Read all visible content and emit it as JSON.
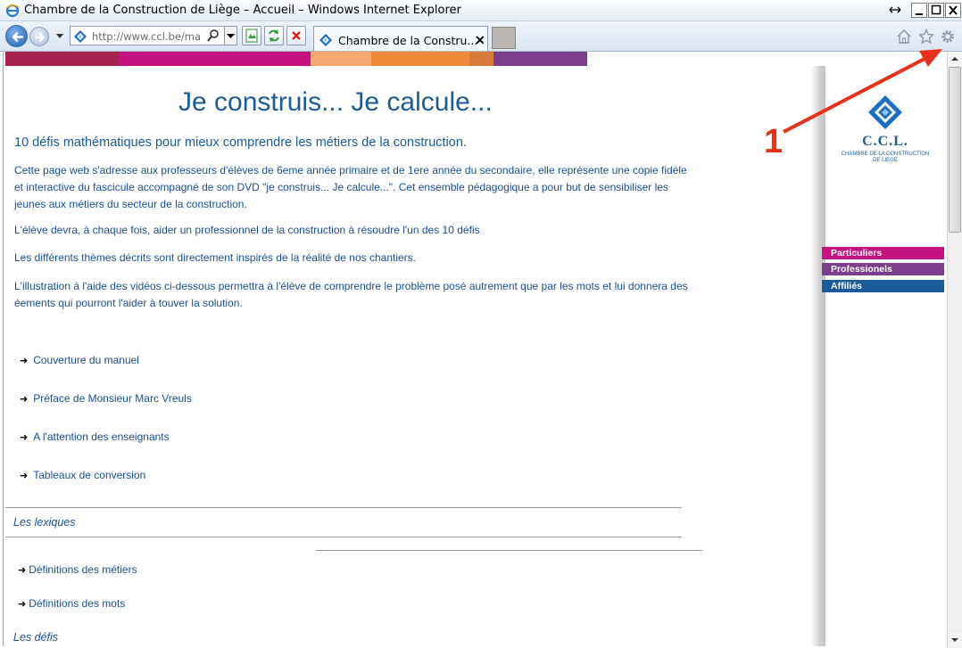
{
  "window": {
    "title": "Chambre de la Construction de Liège – Accueil – Windows Internet Explorer"
  },
  "navbar": {
    "url": "http://www.ccl.be/ma",
    "tab_label": "Chambre de la Constru...",
    "tab_close": "✕"
  },
  "page": {
    "heading": "Je construis... Je calcule...",
    "subheading": "10 défis mathématiques pour mieux comprendre les métiers de la construction.",
    "paragraphs": [
      "Cette page web s'adresse aux professeurs d'élèves de 6eme année primaire et de 1ere année du secondaire, elle représente une copie fidèle et interactive du fascicule accompagné de son DVD \"je construis... Je calcule...\". Cet ensemble pédagogique a pour but de sensibiliser les jeunes aux métiers du secteur de la construction.",
      "L'élève devra, à chaque fois, aider un professionnel de la construction à résoudre l'un des 10 défis",
      "Les différents thèmes décrits sont directement inspirés de la réalité de nos chantiers.",
      "L'illustration à l'aide des vidéos ci-dessous permettra à l'élève de comprendre le problème posé autrement que par les mots et lui donnera des éements qui pourront l'aider à touver la solution."
    ],
    "links": [
      "Couverture du manuel",
      "Préface de Monsieur Marc Vreuls",
      "A l'attention des enseignants",
      "Tableaux de conversion"
    ],
    "section_lexiques": "Les lexiques",
    "lexique_links": [
      "Définitions des métiers",
      "Définitions des mots"
    ],
    "section_defis": "Les défis",
    "arrow_glyph": "➜"
  },
  "sidebar": {
    "logo_text": "C.C.L.",
    "logo_org": "CHAMBRE DE LA CONSTRUCTION DE LIEGE",
    "buttons": [
      {
        "label": "Particuliers",
        "color": "#c4127f"
      },
      {
        "label": "Professionels",
        "color": "#7a3e8c"
      },
      {
        "label": "Affiliés",
        "color": "#1a5a9a"
      }
    ]
  },
  "colors": {
    "brand_blue": "#1c5a9a",
    "band": [
      "#a8224f",
      "#c4127f",
      "#f2a86e",
      "#ee8a3a",
      "#d97a3a",
      "#7a3e8c"
    ]
  },
  "annotation": {
    "number": "1",
    "color": "#e8301a",
    "target": "gear-icon"
  }
}
